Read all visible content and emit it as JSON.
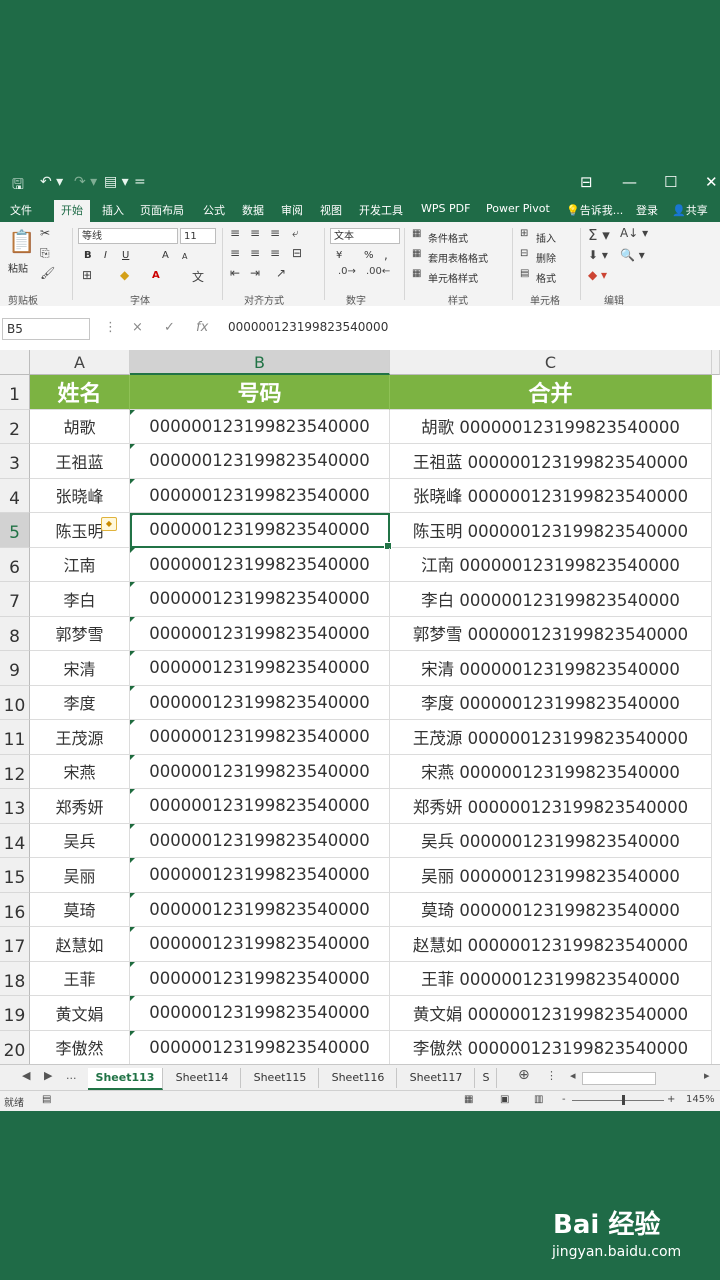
{
  "quick_access": {
    "save_icon": "save-icon",
    "undo_icon": "undo-icon",
    "redo_icon": "redo-icon",
    "form_icon": "form-icon",
    "customize": "="
  },
  "menu": {
    "items": [
      "文件",
      "开始",
      "插入",
      "页面布局",
      "公式",
      "数据",
      "审阅",
      "视图",
      "开发工具",
      "WPS PDF",
      "Power Pivot",
      "告诉我...",
      "登录",
      "共享"
    ],
    "active_index": 1
  },
  "ribbon": {
    "paste": "粘贴",
    "font_name": "等线",
    "font_size": "11",
    "number_format": "文本",
    "bold": "B",
    "italic": "I",
    "underline": "U",
    "grow_font": "A",
    "shrink_font": "A",
    "currency": "¥",
    "percent": "%",
    "cond_format": "条件格式",
    "table_format": "套用表格格式",
    "cell_styles": "单元格样式",
    "insert": "插入",
    "delete": "删除",
    "format": "格式",
    "groups": [
      "剪贴板",
      "字体",
      "对齐方式",
      "数字",
      "样式",
      "单元格",
      "编辑"
    ]
  },
  "formula_bar": {
    "name_box": "B5",
    "cancel": "×",
    "enter": "✓",
    "fx": "fx",
    "value": "000000123199823540000"
  },
  "columns": [
    "A",
    "B",
    "C"
  ],
  "selected_column": "B",
  "selected_row": 5,
  "header_row": {
    "name": "姓名",
    "number": "号码",
    "merged": "合并"
  },
  "rows": [
    {
      "row": "2",
      "name": "胡歌",
      "number": "000000123199823540000",
      "merged": "胡歌 000000123199823540000"
    },
    {
      "row": "3",
      "name": "王祖蓝",
      "number": "000000123199823540000",
      "merged": "王祖蓝 000000123199823540000"
    },
    {
      "row": "4",
      "name": "张晓峰",
      "number": "000000123199823540000",
      "merged": "张晓峰 000000123199823540000"
    },
    {
      "row": "5",
      "name": "陈玉明",
      "number": "000000123199823540000",
      "merged": "陈玉明 000000123199823540000"
    },
    {
      "row": "6",
      "name": "江南",
      "number": "000000123199823540000",
      "merged": "江南 000000123199823540000"
    },
    {
      "row": "7",
      "name": "李白",
      "number": "000000123199823540000",
      "merged": "李白 000000123199823540000"
    },
    {
      "row": "8",
      "name": "郭梦雪",
      "number": "000000123199823540000",
      "merged": "郭梦雪 000000123199823540000"
    },
    {
      "row": "9",
      "name": "宋清",
      "number": "000000123199823540000",
      "merged": "宋清 000000123199823540000"
    },
    {
      "row": "10",
      "name": "李度",
      "number": "000000123199823540000",
      "merged": "李度 000000123199823540000"
    },
    {
      "row": "11",
      "name": "王茂源",
      "number": "000000123199823540000",
      "merged": "王茂源 000000123199823540000"
    },
    {
      "row": "12",
      "name": "宋燕",
      "number": "000000123199823540000",
      "merged": "宋燕 000000123199823540000"
    },
    {
      "row": "13",
      "name": "郑秀妍",
      "number": "000000123199823540000",
      "merged": "郑秀妍 000000123199823540000"
    },
    {
      "row": "14",
      "name": "吴兵",
      "number": "000000123199823540000",
      "merged": "吴兵 000000123199823540000"
    },
    {
      "row": "15",
      "name": "吴丽",
      "number": "000000123199823540000",
      "merged": "吴丽 000000123199823540000"
    },
    {
      "row": "16",
      "name": "莫琦",
      "number": "000000123199823540000",
      "merged": "莫琦 000000123199823540000"
    },
    {
      "row": "17",
      "name": "赵慧如",
      "number": "000000123199823540000",
      "merged": "赵慧如 000000123199823540000"
    },
    {
      "row": "18",
      "name": "王菲",
      "number": "000000123199823540000",
      "merged": "王菲 000000123199823540000"
    },
    {
      "row": "19",
      "name": "黄文娟",
      "number": "000000123199823540000",
      "merged": "黄文娟 000000123199823540000"
    },
    {
      "row": "20",
      "name": "李傲然",
      "number": "000000123199823540000",
      "merged": "李傲然 000000123199823540000"
    }
  ],
  "sheet_tabs": {
    "ellipsis": "...",
    "tabs": [
      "Sheet113",
      "Sheet114",
      "Sheet115",
      "Sheet116",
      "Sheet117",
      "S"
    ],
    "active_index": 0,
    "add": "⊕"
  },
  "status_bar": {
    "ready": "就绪",
    "zoom": "145%",
    "minus": "-",
    "plus": "+"
  },
  "watermark": {
    "logo": "Bai 经验",
    "url": "jingyan.baidu.com"
  },
  "colors": {
    "accent": "#217346",
    "header_fill": "#7cb342",
    "background": "#1f6b47"
  }
}
